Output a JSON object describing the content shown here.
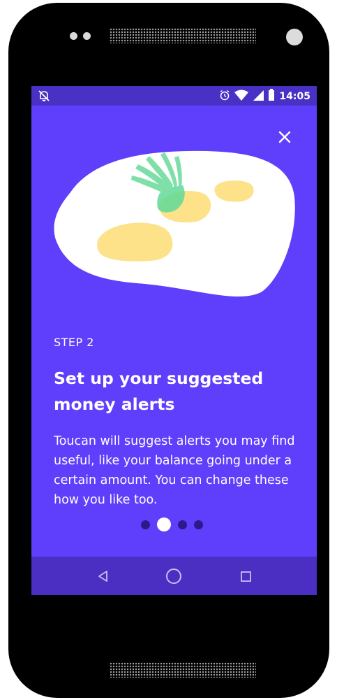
{
  "status_bar": {
    "time": "14:05",
    "icons": [
      "notifications-off-icon",
      "alarm-icon",
      "wifi-icon",
      "cell-signal-icon",
      "battery-icon"
    ]
  },
  "onboarding": {
    "step_label": "STEP 2",
    "title": "Set up your suggested money alerts",
    "body": "Toucan will suggest alerts you may find useful, like your balance going under a certain amount. You can change these how you like too.",
    "page_count": 4,
    "active_page": 2,
    "close_icon": "close-icon"
  },
  "nav_bar": {
    "buttons": [
      "back-icon",
      "home-icon",
      "recents-icon"
    ]
  },
  "colors": {
    "background": "#5f3ffb",
    "status_bar": "#4a31c5",
    "nav_bar": "#4a2fc2",
    "blob": "#ffffff",
    "coin_yellow": "#fde28a",
    "leaf_green": "#7ee0a8",
    "inactive_dot": "#2a1a8a"
  }
}
